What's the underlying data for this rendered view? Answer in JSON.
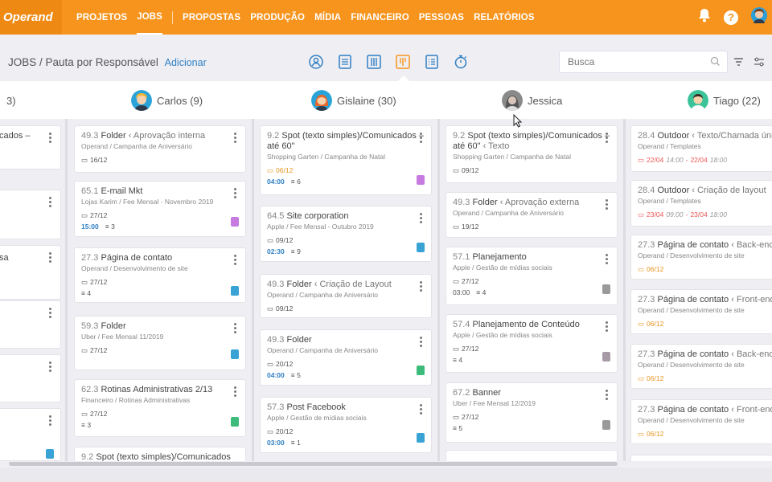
{
  "nav": {
    "logo": "Operand",
    "items": [
      "PROJETOS",
      "JOBS",
      "PROPOSTAS",
      "PRODUÇÃO",
      "MÍDIA",
      "FINANCEIRO",
      "PESSOAS",
      "RELATÓRIOS"
    ],
    "active": "JOBS"
  },
  "header": {
    "breadcrumb": "JOBS / Pauta por Responsável",
    "add_link": "Adicionar",
    "search_placeholder": "Busca"
  },
  "people": [
    {
      "name": "3)",
      "count": ""
    },
    {
      "name": "Carlos",
      "count": "(9)"
    },
    {
      "name": "Gislaine",
      "count": "(30)"
    },
    {
      "name": "Jessica",
      "count": ""
    },
    {
      "name": "Tiago",
      "count": "(22)"
    }
  ],
  "columns": {
    "col0": [
      {
        "title": "cados –"
      },
      {
        "title": ""
      },
      {
        "title": "sa"
      },
      {
        "title": ""
      },
      {
        "title": ""
      },
      {
        "title": ""
      },
      {
        "title": ""
      }
    ],
    "col1": [
      {
        "code": "49.3",
        "name": "Folder",
        "step": "Aprovação interna",
        "sub": "Operand / Campanha de Aniversário",
        "date": "16/12"
      },
      {
        "code": "65.1",
        "name": "E-mail Mkt",
        "step": "",
        "sub": "Lojas Karim / Fee Mensal - Novembro 2019",
        "date": "27/12",
        "time": "15:00",
        "count": "3"
      },
      {
        "code": "27.3",
        "name": "Página de contato",
        "step": "",
        "sub": "Operand / Desenvolvimento de site",
        "date": "27/12",
        "count": "4"
      },
      {
        "code": "59.3",
        "name": "Folder",
        "step": "",
        "sub": "Uber / Fee Mensal 11/2019",
        "date": "27/12"
      },
      {
        "code": "62.3",
        "name": "Rotinas Administrativas 2/13",
        "step": "",
        "sub": "Financeiro / Rotinas Administrativas",
        "date": "27/12",
        "count": "3"
      },
      {
        "code": "9.2",
        "name": "Spot (texto simples)/Comunicados",
        "step": "",
        "sub": "",
        "date": ""
      }
    ],
    "col2": [
      {
        "code": "9.2",
        "name": "Spot (texto simples)/Comunicados –",
        "name2": "até 60\"",
        "step": "",
        "sub": "Shopping Garten / Campanha de Natal",
        "date": "06/12",
        "time": "04:00",
        "count": "6"
      },
      {
        "code": "64.5",
        "name": "Site corporation",
        "step": "",
        "sub": "Apple / Fee Mensal - Outubro 2019",
        "date": "09/12",
        "time": "02:30",
        "count": "9"
      },
      {
        "code": "49.3",
        "name": "Folder",
        "step": "Criação de Layout",
        "sub": "Operand / Campanha de Aniversário",
        "date": "09/12"
      },
      {
        "code": "49.3",
        "name": "Folder",
        "step": "",
        "sub": "Operand / Campanha de Aniversário",
        "date": "20/12",
        "time": "04:00",
        "count": "5"
      },
      {
        "code": "57.3",
        "name": "Post Facebook",
        "step": "",
        "sub": "Apple / Gestão de mídias sociais",
        "date": "20/12",
        "time": "03:00",
        "count": "1"
      }
    ],
    "col3": [
      {
        "code": "9.2",
        "name": "Spot (texto simples)/Comunicados –",
        "name2": "até 60\"",
        "step": "Texto",
        "sub": "Shopping Garten / Campanha de Natal",
        "date": "09/12"
      },
      {
        "code": "49.3",
        "name": "Folder",
        "step": "Aprovação externa",
        "sub": "Operand / Campanha de Aniversário",
        "date": "19/12"
      },
      {
        "code": "57.1",
        "name": "Planejamento",
        "step": "",
        "sub": "Apple / Gestão de mídias sociais",
        "date": "27/12",
        "time": "03:00",
        "count": "4"
      },
      {
        "code": "57.4",
        "name": "Planejamento de Conteúdo",
        "step": "",
        "sub": "Apple / Gestão de mídias sociais",
        "date": "27/12",
        "count": "4"
      },
      {
        "code": "67.2",
        "name": "Banner",
        "step": "",
        "sub": "Uber / Fee Mensal 12/2019",
        "date": "27/12",
        "count": "5"
      }
    ],
    "col4": [
      {
        "code": "28.4",
        "name": "Outdoor",
        "step": "Texto/Chamada única",
        "sub": "Operand / Templates",
        "date": "22/04",
        "hour1": "14:00",
        "date2": "22/04",
        "hour2": "18:00"
      },
      {
        "code": "28.4",
        "name": "Outdoor",
        "step": "Criação de layout",
        "sub": "Operand / Templates",
        "date": "23/04",
        "hour1": "09:00",
        "date2": "23/04",
        "hour2": "18:00"
      },
      {
        "code": "27.3",
        "name": "Página de contato",
        "step": "Back-end",
        "sub": "Operand / Desenvolvimento de site",
        "date": "06/12"
      },
      {
        "code": "27.3",
        "name": "Página de contato",
        "step": "Front-end",
        "sub": "Operand / Desenvolvimento de site",
        "date": "06/12"
      },
      {
        "code": "27.3",
        "name": "Página de contato",
        "step": "Back-end",
        "sub": "Operand / Desenvolvimento de site",
        "date": "06/12"
      },
      {
        "code": "27.3",
        "name": "Página de contato",
        "step": "Front-end",
        "sub": "Operand / Desenvolvimento de site",
        "date": "06/12"
      }
    ]
  },
  "colors": {
    "brand_orange": "#f7941d",
    "link_blue": "#2f7fc4",
    "tag_purple": "#c77be0",
    "tag_blue": "#3aa3d6",
    "tag_green": "#3dbb7a",
    "tag_gray": "#9a9a9a",
    "tag_mauve": "#a89ba8"
  }
}
